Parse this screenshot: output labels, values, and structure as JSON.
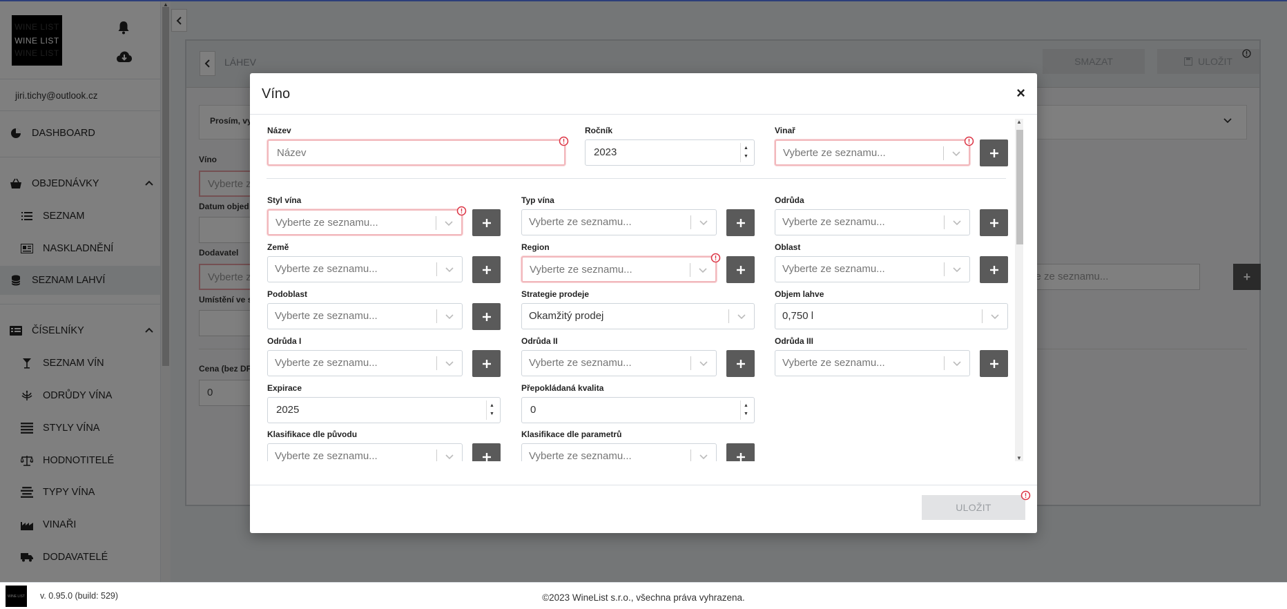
{
  "app": {
    "logo_text": "WINE LIST",
    "user_email": "jiri.tichy@outlook.cz",
    "version": "v. 0.95.0 (build: 529)",
    "copyright": "©2023 WineList s.r.o., všechna práva vyhrazena."
  },
  "sidebar": {
    "items": [
      {
        "label": "DASHBOARD",
        "icon": "dashboard-icon"
      },
      {
        "label": "OBJEDNÁVKY",
        "icon": "basket-icon"
      },
      {
        "label": "SEZNAM",
        "icon": "list-icon"
      },
      {
        "label": "NASKLADNĚNÍ",
        "icon": "stock-icon"
      },
      {
        "label": "SEZNAM LAHVÍ",
        "icon": "database-icon"
      },
      {
        "label": "ČÍSELNÍKY",
        "icon": "table-icon"
      },
      {
        "label": "SEZNAM VÍN",
        "icon": "glass-icon"
      },
      {
        "label": "ODRŮDY VÍNA",
        "icon": "grape-icon"
      },
      {
        "label": "STYLY VÍNA",
        "icon": "lines-icon"
      },
      {
        "label": "HODNOTITELÉ",
        "icon": "scale-icon"
      },
      {
        "label": "TYPY VÍNA",
        "icon": "menu-icon"
      },
      {
        "label": "VINAŘI",
        "icon": "industry-icon"
      },
      {
        "label": "DODAVATELÉ",
        "icon": "truck-icon"
      }
    ]
  },
  "background_page": {
    "title": "LÁHEV",
    "delete_label": "SMAZAT",
    "save_label": "ULOŽIT",
    "notice": "Prosím, vy",
    "labels": {
      "wine": "Víno",
      "order_date": "Datum objed",
      "supplier": "Dodavatel",
      "location": "Umístění ve s",
      "price": "Cena (bez DP"
    },
    "wine_placeholder": "Vyberte z",
    "supplier_placeholder": "Vyberte z",
    "price_value": "0",
    "right_select_placeholder": "erte ze seznamu..."
  },
  "modal": {
    "title": "Víno",
    "close": "×",
    "save_label": "ULOŽIT",
    "select_placeholder": "Vyberte ze seznamu...",
    "fields": {
      "name": {
        "label": "Název",
        "placeholder": "Název"
      },
      "vintage": {
        "label": "Ročník",
        "value": "2023"
      },
      "winemaker": {
        "label": "Vinař"
      },
      "style": {
        "label": "Styl vína"
      },
      "type": {
        "label": "Typ vína"
      },
      "variety": {
        "label": "Odrůda"
      },
      "country": {
        "label": "Země"
      },
      "region": {
        "label": "Region"
      },
      "area": {
        "label": "Oblast"
      },
      "subarea": {
        "label": "Podoblast"
      },
      "strategy": {
        "label": "Strategie prodeje",
        "value": "Okamžitý prodej"
      },
      "volume": {
        "label": "Objem lahve",
        "value": "0,750 l"
      },
      "variety1": {
        "label": "Odrůda I"
      },
      "variety2": {
        "label": "Odrůda II"
      },
      "variety3": {
        "label": "Odrůda III"
      },
      "expiration": {
        "label": "Expirace",
        "value": "2025"
      },
      "quality": {
        "label": "Přepokládaná kvalita",
        "value": "0"
      },
      "class_origin": {
        "label": "Klasifikace dle původu"
      },
      "class_params": {
        "label": "Klasifikace dle parametrů"
      }
    }
  },
  "colors": {
    "error": "#dc3545",
    "plus_button": "#5a5a5a",
    "error_border": "#f2b8bc"
  }
}
